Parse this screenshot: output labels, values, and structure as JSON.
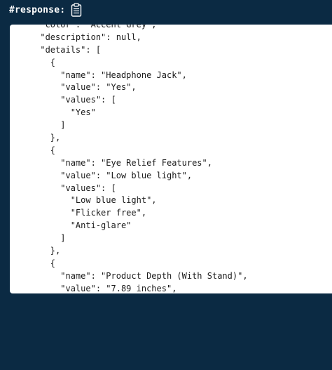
{
  "header": {
    "label": "#response:",
    "copy_icon": "clipboard-icon"
  },
  "code": {
    "lines": [
      "      \"color\": \"Accent Grey\",",
      "      \"description\": null,",
      "      \"details\": [",
      "        {",
      "          \"name\": \"Headphone Jack\",",
      "          \"value\": \"Yes\",",
      "          \"values\": [",
      "            \"Yes\"",
      "          ]",
      "        },",
      "        {",
      "          \"name\": \"Eye Relief Features\",",
      "          \"value\": \"Low blue light\",",
      "          \"values\": [",
      "            \"Low blue light\",",
      "            \"Flicker free\",",
      "            \"Anti-glare\"",
      "          ]",
      "        },",
      "        {",
      "          \"name\": \"Product Depth (With Stand)\",",
      "          \"value\": \"7.89 inches\","
    ]
  }
}
